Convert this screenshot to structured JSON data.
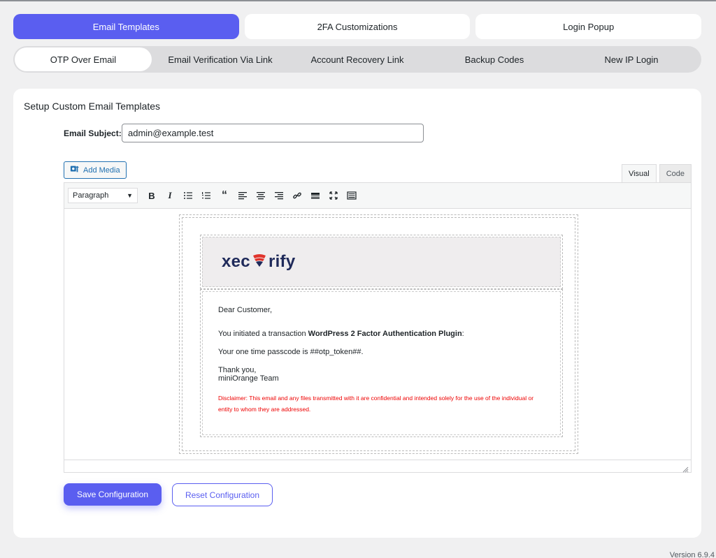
{
  "main_tabs": [
    {
      "label": "Email Templates",
      "active": true
    },
    {
      "label": "2FA Customizations",
      "active": false
    },
    {
      "label": "Login Popup",
      "active": false
    }
  ],
  "sub_tabs": [
    {
      "label": "OTP Over Email",
      "active": true
    },
    {
      "label": "Email Verification Via Link",
      "active": false
    },
    {
      "label": "Account Recovery Link",
      "active": false
    },
    {
      "label": "Backup Codes",
      "active": false
    },
    {
      "label": "New IP Login",
      "active": false
    }
  ],
  "card": {
    "title": "Setup Custom Email Templates",
    "subject_label": "Email Subject:",
    "subject_value": "admin@example.test"
  },
  "editor": {
    "add_media_label": "Add Media",
    "mode_visual": "Visual",
    "mode_code": "Code",
    "format_select": "Paragraph",
    "toolbar_icons": [
      "bold-icon",
      "italic-icon",
      "bullet-list-icon",
      "numbered-list-icon",
      "blockquote-icon",
      "align-left-icon",
      "align-center-icon",
      "align-right-icon",
      "link-icon",
      "read-more-icon",
      "fullscreen-icon",
      "toolbar-toggle-icon"
    ]
  },
  "email": {
    "logo_left": "xec",
    "logo_right": "rify",
    "greeting": "Dear Customer,",
    "transaction_prefix": "You initiated a transaction ",
    "transaction_bold": "WordPress 2 Factor Authentication Plugin",
    "transaction_suffix": ":",
    "passcode_line": "Your one time passcode is ##otp_token##.",
    "thanks": "Thank you,",
    "team": "miniOrange Team",
    "disclaimer": "Disclaimer: This email and any files transmitted with it are confidential and intended solely for the use of the individual or entity to whom they are addressed."
  },
  "actions": {
    "save_label": "Save Configuration",
    "reset_label": "Reset Configuration"
  },
  "footer": {
    "version": "Version 6.9.4"
  },
  "colors": {
    "accent": "#5a5ef0",
    "disclaimer": "#ee0000",
    "logo": "#1f2a5a",
    "logo_accent": "#e0342c"
  }
}
